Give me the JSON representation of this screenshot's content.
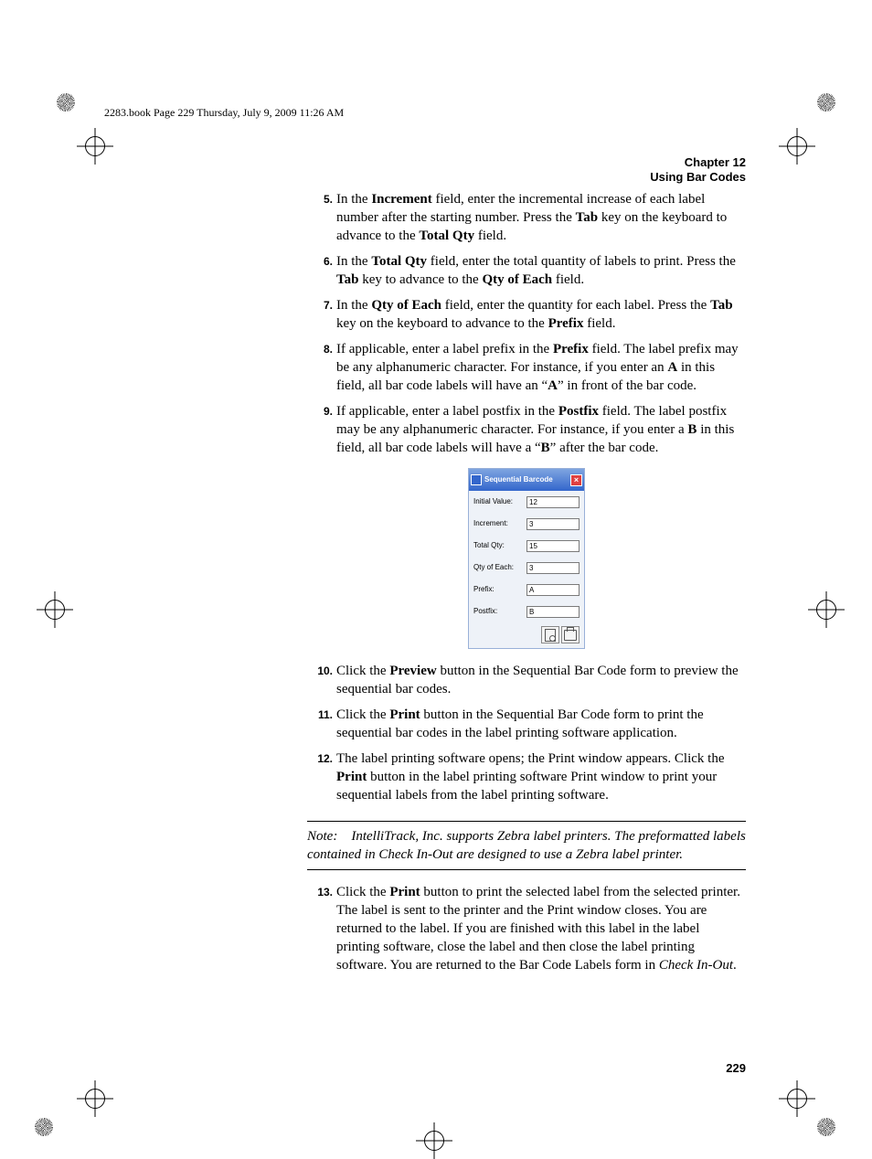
{
  "page_header": "2283.book  Page 229  Thursday, July 9, 2009   11:26 AM",
  "chapter": {
    "line1": "Chapter 12",
    "line2": "Using Bar Codes"
  },
  "steps": {
    "s5": {
      "num": "5.",
      "html": "In the <b>Increment</b> field, enter the incremental increase of each label number after the starting number. Press the <b>Tab</b> key on the keyboard to advance to the <b>Total Qty</b> field."
    },
    "s6": {
      "num": "6.",
      "html": "In the <b>Total Qty</b> field, enter the total quantity of labels to print. Press the <b>Tab</b> key to advance to the <b>Qty of Each</b> field."
    },
    "s7": {
      "num": "7.",
      "html": "In the <b>Qty of Each</b> field, enter the quantity for each label. Press the <b>Tab</b> key on the keyboard to advance to the <b>Prefix</b> field."
    },
    "s8": {
      "num": "8.",
      "html": "If applicable, enter a label prefix in the <b>Prefix</b> field. The label prefix may be any alphanumeric character. For instance, if you enter an <b>A</b> in this field, all bar code labels will have an “<b>A</b>” in front of the bar code."
    },
    "s9": {
      "num": "9.",
      "html": "If applicable, enter a label postfix in the <b>Postfix</b> field. The label postfix may be any alphanumeric character. For instance, if you enter a <b>B</b> in this field, all bar code labels will have a “<b>B</b>” after the bar code."
    },
    "s10": {
      "num": "10.",
      "html": "Click the <b>Preview</b> button in the Sequential Bar Code form to preview the sequential bar codes."
    },
    "s11": {
      "num": "11.",
      "html": "Click the <b>Print</b> button in the Sequential Bar Code form to print the sequential bar codes in the label printing software application."
    },
    "s12": {
      "num": "12.",
      "html": "The label printing software opens; the Print window appears. Click the <b>Print</b> button in the label printing software Print window to print your sequential labels from the label printing software."
    },
    "s13": {
      "num": "13.",
      "html": "Click the <b>Print</b> button to print the selected label from the selected printer. The label is sent to the printer and the Print window closes. You are returned to the label. If you are finished with this label in the label printing software, close the label and then close the label printing software. You are returned to the Bar Code Labels form in <i>Check In-Out</i>."
    }
  },
  "dialog": {
    "title": "Sequential Barcode",
    "fields": {
      "initial_value": {
        "label": "Initial Value:",
        "value": "12"
      },
      "increment": {
        "label": "Increment:",
        "value": "3"
      },
      "total_qty": {
        "label": "Total Qty:",
        "value": "15"
      },
      "qty_of_each": {
        "label": "Qty of Each:",
        "value": "3"
      },
      "prefix": {
        "label": "Prefix:",
        "value": "A"
      },
      "postfix": {
        "label": "Postfix:",
        "value": "B"
      }
    }
  },
  "note": "Note: IntelliTrack, Inc. supports Zebra label printers. The preformatted labels contained in Check In-Out are designed to use a Zebra label printer.",
  "page_number": "229"
}
